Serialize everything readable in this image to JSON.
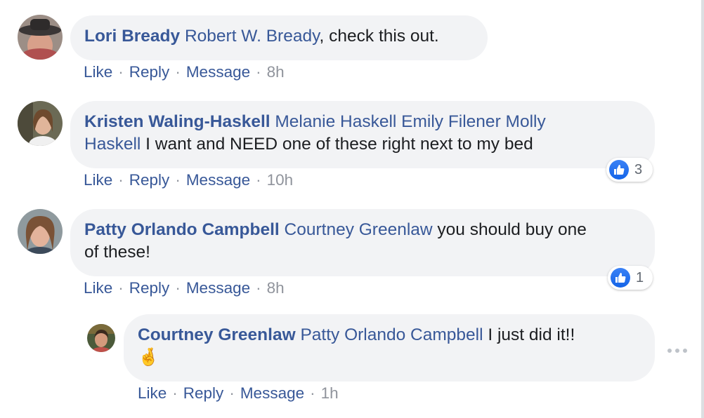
{
  "comments": [
    {
      "author": "Lori Bready",
      "mentions": [
        "Robert W. Bready"
      ],
      "text": ", check this out.",
      "actions": {
        "like": "Like",
        "reply": "Reply",
        "message": "Message",
        "time": "8h"
      }
    },
    {
      "author": "Kristen Waling-Haskell",
      "mentions": [
        "Melanie Haskell",
        "Emily Filener",
        "Molly",
        "Haskell"
      ],
      "text": " I want and NEED one of these right next to my bed",
      "actions": {
        "like": "Like",
        "reply": "Reply",
        "message": "Message",
        "time": "10h"
      },
      "reactions": {
        "icon": "thumbs-up-icon",
        "count": "3"
      }
    },
    {
      "author": "Patty Orlando Campbell",
      "mentions": [
        "Courtney Greenlaw"
      ],
      "text_line1": " you should buy one",
      "text_line2": "of these!",
      "actions": {
        "like": "Like",
        "reply": "Reply",
        "message": "Message",
        "time": "8h"
      },
      "reactions": {
        "icon": "thumbs-up-icon",
        "count": "1"
      }
    },
    {
      "author": "Courtney Greenlaw",
      "mentions": [
        "Patty Orlando Campbell"
      ],
      "text": " I just did it!!",
      "emoji": "🤞",
      "actions": {
        "like": "Like",
        "reply": "Reply",
        "message": "Message",
        "time": "1h"
      }
    }
  ],
  "separator": "·",
  "colors": {
    "link": "#385898",
    "bubble": "#f2f3f5",
    "meta": "#90949c",
    "like_blue": "#1877f2"
  }
}
